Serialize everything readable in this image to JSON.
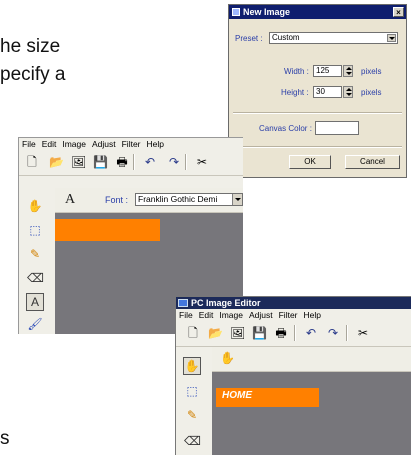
{
  "background_text": {
    "line1": "he size",
    "line2": "pecify a",
    "line3": "s"
  },
  "new_image_dialog": {
    "title": "New Image",
    "close": "×",
    "preset_label": "Preset :",
    "preset_value": "Custom",
    "width_label": "Width :",
    "width_value": "125",
    "width_unit": "pixels",
    "height_label": "Height :",
    "height_value": "30",
    "height_unit": "pixels",
    "canvas_color_label": "Canvas Color :",
    "ok_label": "OK",
    "cancel_label": "Cancel"
  },
  "editor_back": {
    "menu": [
      "File",
      "Edit",
      "Image",
      "Adjust",
      "Filter",
      "Help"
    ],
    "font_tool_glyph": "A",
    "font_label": "Font :",
    "font_value": "Franklin Gothic Demi",
    "text_tool_glyph": "A",
    "banner_color": "#ff8000"
  },
  "editor_front": {
    "title": "PC Image Editor",
    "menu": [
      "File",
      "Edit",
      "Image",
      "Adjust",
      "Filter",
      "Help"
    ],
    "banner_text": "HOME",
    "banner_color": "#ff8000"
  }
}
